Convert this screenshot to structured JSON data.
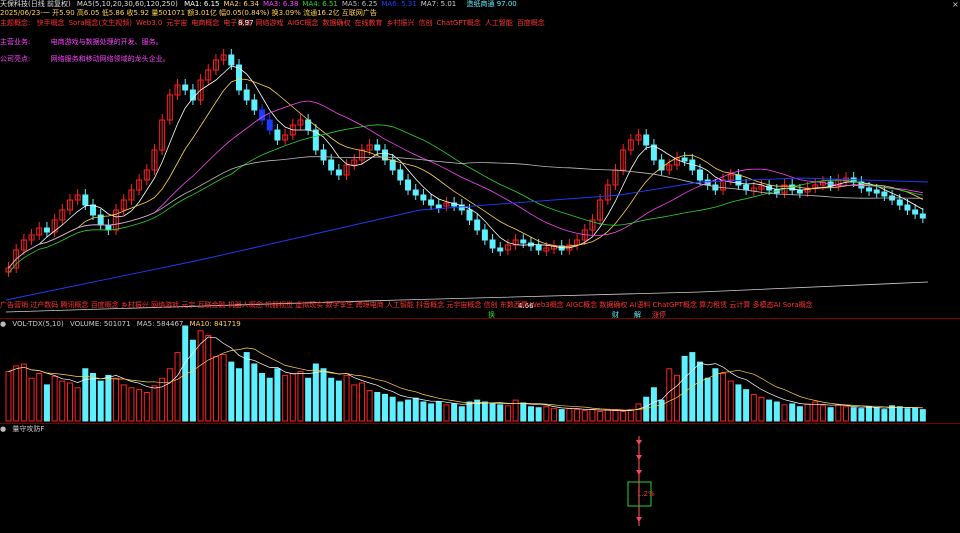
{
  "colors": {
    "up": "#ff2020",
    "down": "#5ff0ff",
    "blue_candle": "#1a3cff",
    "ma1": "#ffffff",
    "ma2": "#ffd24a",
    "ma3": "#ff40ff",
    "ma4": "#29d22b",
    "ma5": "#bbbbbb",
    "ma6": "#1d3cff",
    "ma7": "#d0d0d0"
  },
  "header": {
    "stock": "天保科技(日线 前复权)",
    "ma_params": "MA5(5,10,20,30,60,120,250)",
    "ma": [
      {
        "label": "MA1: 6.15",
        "color": "#ffffff"
      },
      {
        "label": "MA2: 6.34",
        "color": "#ffd24a"
      },
      {
        "label": "MA3: 6.38",
        "color": "#ff40ff"
      },
      {
        "label": "MA4: 6.51",
        "color": "#29d22b"
      },
      {
        "label": "MA5: 6.25",
        "color": "#bbbbbb"
      },
      {
        "label": "MA6: 5.31",
        "color": "#1d3cff"
      },
      {
        "label": "MA7: 5.01",
        "color": "#d0d0d0"
      }
    ],
    "sector": "造纸商通 97.00",
    "quote": "2025/06/23-一 开5.90 高6.05 低5.86 收5.92 量501071 额3.01亿 幅0.05(0.84%) 换3.09% 流通16.2亿 互联网广告"
  },
  "concepts": {
    "row1_label": "主题概念:",
    "row1_items": [
      "快手概念",
      "Sora概念(文生视频)",
      "Web3.0",
      "元宇宙",
      "电商概念",
      "电子竞技",
      "网络游戏",
      "AIGC概念",
      "数据确权",
      "在线教育",
      "乡村振兴",
      "信创",
      "ChatGPT概念",
      "人工智能",
      "百度概念"
    ],
    "row2_label": "主营业务:",
    "row2_text": "电商游戏与数据处理的开发、服务。",
    "row3_label": "公司亮点:",
    "row3_text": "网络服务和移动网络领域的龙头企业。"
  },
  "chart": {
    "last_close": "5.92",
    "high_label": "8.97",
    "low_label": "4.66",
    "bottom_concepts": "广告营销 过产数码 腾讯概念 百度概念 乡村振兴 网络游戏 元宇 互联金融 机器人概念 机器视觉 虚拟现实 数字孪生 跨境电商 人工智能 抖音概念 元宇宙概念 信创 东数西算 Web3概念 AIGC概念 数据确权 AI语料 ChatGPT概念 算力租赁 云计算 多模态AI Sora概念",
    "tags": [
      {
        "text": "换",
        "color": "#29d22b"
      },
      {
        "text": "财",
        "color": "#5ff0ff"
      },
      {
        "text": "解",
        "color": "#5ff0ff"
      },
      {
        "text": "涨停",
        "color": "#ff4040"
      }
    ]
  },
  "volume": {
    "title": "VOL-TDX(5,10)",
    "vol": "VOLUME: 501071",
    "ma5": "MA5: 584467",
    "ma10": "MA10: 841719",
    "series": [
      0.52,
      0.58,
      0.6,
      0.45,
      0.5,
      0.38,
      0.47,
      0.42,
      0.4,
      0.35,
      0.55,
      0.5,
      0.42,
      0.48,
      0.45,
      0.38,
      0.35,
      0.33,
      0.3,
      0.37,
      0.45,
      0.55,
      0.72,
      1.0,
      0.85,
      0.95,
      0.9,
      0.68,
      0.7,
      0.62,
      0.55,
      0.72,
      0.6,
      0.5,
      0.45,
      0.55,
      0.48,
      0.5,
      0.52,
      0.45,
      0.6,
      0.55,
      0.45,
      0.42,
      0.48,
      0.38,
      0.4,
      0.32,
      0.3,
      0.28,
      0.25,
      0.2,
      0.22,
      0.24,
      0.2,
      0.18,
      0.2,
      0.17,
      0.18,
      0.15,
      0.2,
      0.22,
      0.2,
      0.18,
      0.17,
      0.16,
      0.22,
      0.19,
      0.15,
      0.14,
      0.15,
      0.13,
      0.12,
      0.13,
      0.12,
      0.11,
      0.12,
      0.1,
      0.12,
      0.11,
      0.1,
      0.12,
      0.18,
      0.25,
      0.35,
      0.22,
      0.55,
      0.48,
      0.68,
      0.72,
      0.62,
      0.45,
      0.55,
      0.5,
      0.42,
      0.38,
      0.33,
      0.28,
      0.25,
      0.22,
      0.2,
      0.17,
      0.18,
      0.15,
      0.18,
      0.2,
      0.16,
      0.14,
      0.17,
      0.15,
      0.14,
      0.13,
      0.15,
      0.14,
      0.12,
      0.16,
      0.15,
      0.13,
      0.14,
      0.12,
      0.12,
      0.11,
      0.1,
      0.1
    ]
  },
  "indicator": {
    "title": "量守攻防F",
    "value": "1.2%"
  }
}
